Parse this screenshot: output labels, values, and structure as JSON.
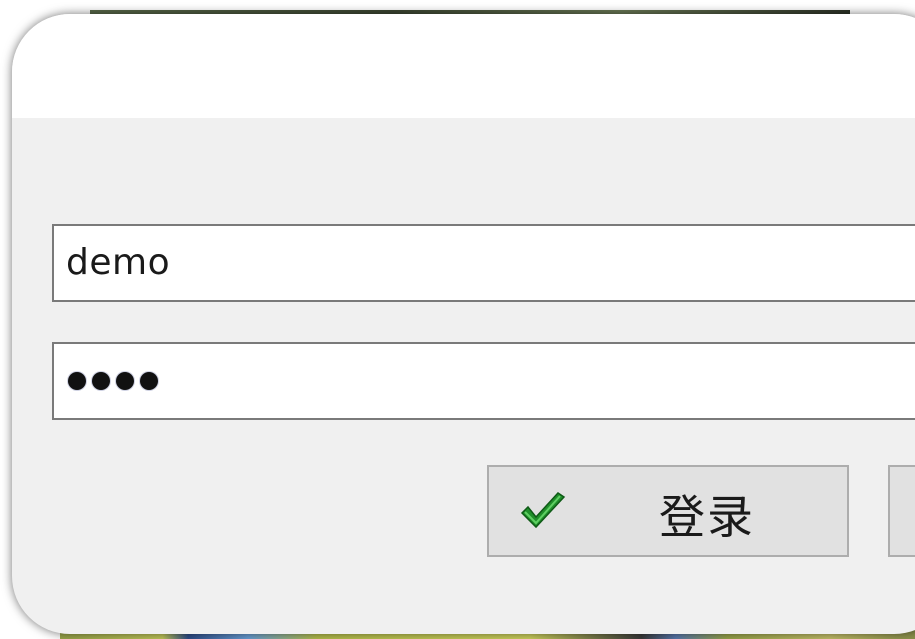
{
  "login_form": {
    "username_value": "demo",
    "password_mask_count": 4,
    "login_button_label": "登录"
  },
  "colors": {
    "check_icon": "#1f8f2a",
    "window_bg": "#f0f0f0",
    "field_border": "#7a7a7a",
    "button_bg": "#e1e1e1"
  },
  "icons": {
    "login_button_icon": "checkmark-icon"
  }
}
